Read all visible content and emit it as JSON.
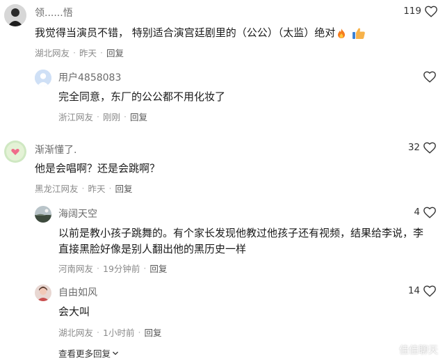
{
  "comments": [
    {
      "username": "领......悟",
      "text": "我觉得当演员不错， 特别适合演宫廷剧里的（公公）（太监）绝对",
      "location": "湖北网友",
      "time": "昨天",
      "reply": "回复",
      "likes": "119"
    },
    {
      "username": "用户4858083",
      "text": "完全同意，东厂的公公都不用化妆了",
      "location": "浙江网友",
      "time": "刚刚",
      "reply": "回复",
      "likes": ""
    },
    {
      "username": "渐渐懂了.",
      "text": "他是会唱啊？还是会跳啊？",
      "location": "黑龙江网友",
      "time": "昨天",
      "reply": "回复",
      "likes": "32"
    },
    {
      "username": "海阔天空",
      "text_line1": "以前是教小孩子跳舞的。有个家长发现他教过他孩子还有视频，结果给李说，李",
      "text_line2": "直接黑脸好像是别人翻出他的黑历史一样",
      "location": "河南网友",
      "time": "19分钟前",
      "reply": "回复",
      "likes": "4"
    },
    {
      "username": "自由如风",
      "text": "会大叫",
      "location": "湖北网友",
      "time": "1小时前",
      "reply": "回复",
      "likes": "14"
    }
  ],
  "more_replies": "查看更多回复",
  "watermark": "佳佳聊天",
  "icons": {
    "like": "heart-outline-icon",
    "fire": "fire-emoji-icon",
    "thumb": "thumbs-up-emoji-icon",
    "chevron": "chevron-down-icon",
    "watermark_logo": "watermark-logo-icon"
  },
  "colors": {
    "username": "#6b6b6b",
    "meta": "#8a8a8a",
    "text": "#1a1a1a"
  }
}
